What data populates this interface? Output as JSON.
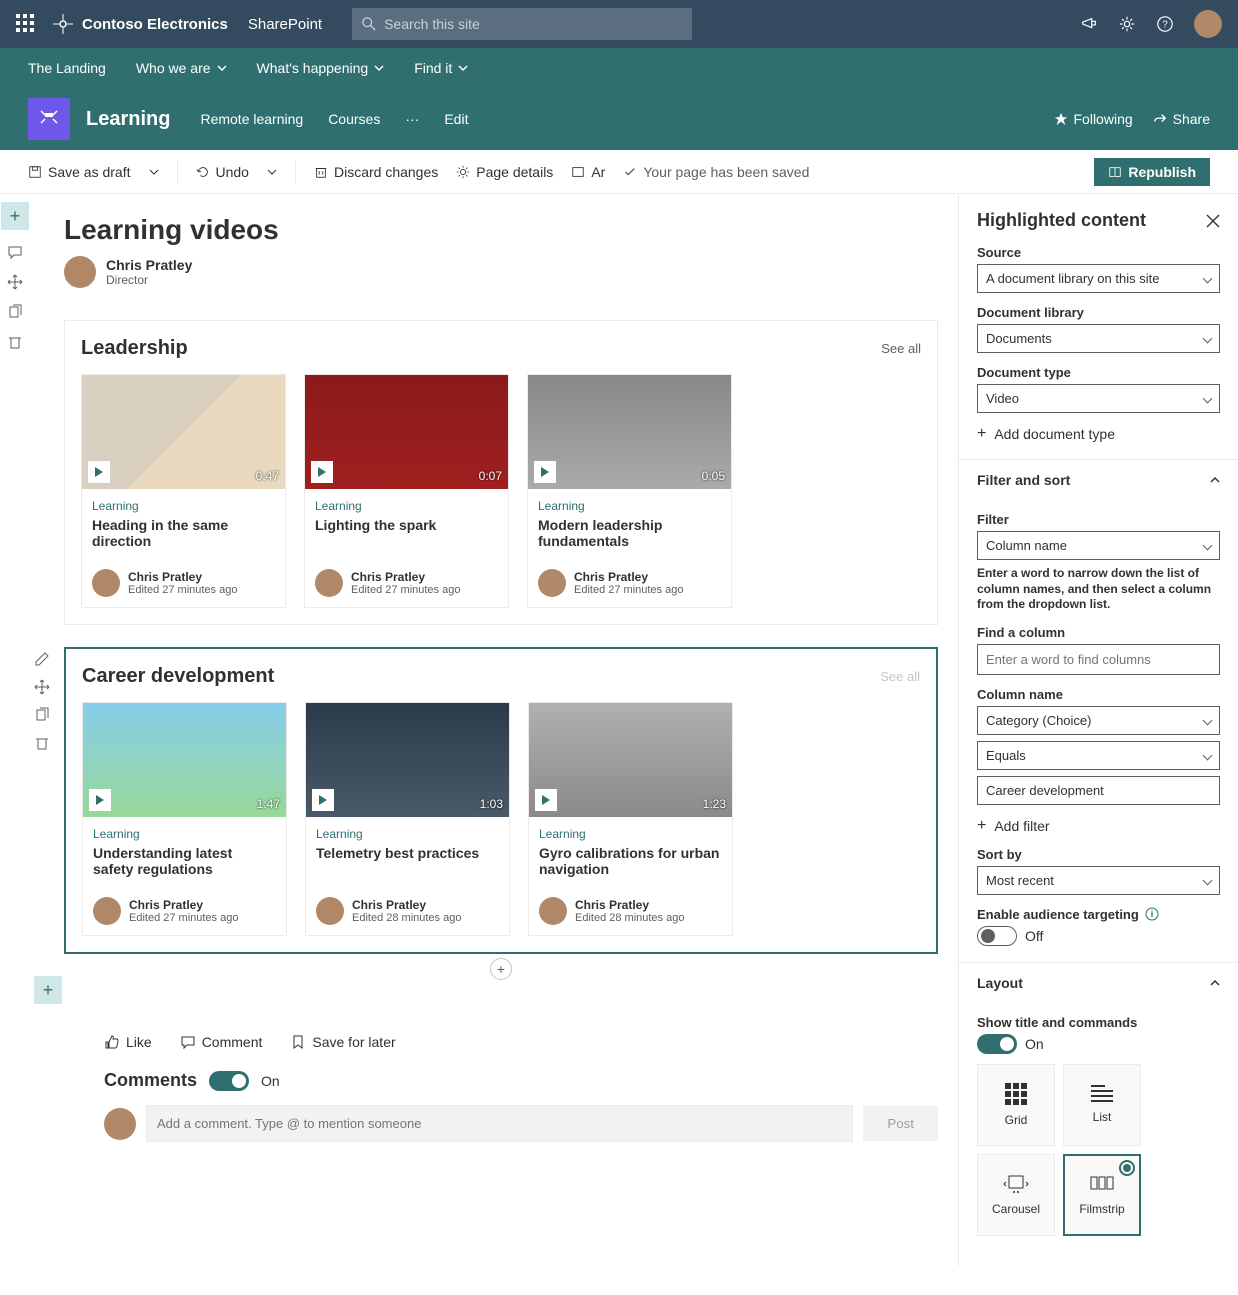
{
  "suite": {
    "brand": "Contoso Electronics",
    "app": "SharePoint",
    "search_placeholder": "Search this site"
  },
  "hubnav": {
    "items": [
      "The Landing",
      "Who we are",
      "What's happening",
      "Find it"
    ]
  },
  "site": {
    "title": "Learning",
    "nav": [
      "Remote learning",
      "Courses"
    ],
    "edit": "Edit",
    "following": "Following",
    "share": "Share"
  },
  "cmdbar": {
    "save": "Save as draft",
    "undo": "Undo",
    "discard": "Discard changes",
    "details": "Page details",
    "ar": "Ar",
    "status": "Your page has been saved",
    "republish": "Republish"
  },
  "page": {
    "title": "Learning videos",
    "author": "Chris Pratley",
    "role": "Director"
  },
  "wp1": {
    "title": "Leadership",
    "seeall": "See all",
    "cards": [
      {
        "cat": "Learning",
        "title": "Heading in the same direction",
        "dur": "0:47",
        "author": "Chris Pratley",
        "edited": "Edited 27 minutes ago"
      },
      {
        "cat": "Learning",
        "title": "Lighting the spark",
        "dur": "0:07",
        "author": "Chris Pratley",
        "edited": "Edited 27 minutes ago"
      },
      {
        "cat": "Learning",
        "title": "Modern leadership fundamentals",
        "dur": "0:05",
        "author": "Chris Pratley",
        "edited": "Edited 27 minutes ago"
      }
    ]
  },
  "wp2": {
    "title": "Career development",
    "seeall": "See all",
    "cards": [
      {
        "cat": "Learning",
        "title": "Understanding latest safety regulations",
        "dur": "1:47",
        "author": "Chris Pratley",
        "edited": "Edited 27 minutes ago"
      },
      {
        "cat": "Learning",
        "title": "Telemetry best practices",
        "dur": "1:03",
        "author": "Chris Pratley",
        "edited": "Edited 28 minutes ago"
      },
      {
        "cat": "Learning",
        "title": "Gyro calibrations for urban navigation",
        "dur": "1:23",
        "author": "Chris Pratley",
        "edited": "Edited 28 minutes ago"
      }
    ]
  },
  "social": {
    "like": "Like",
    "comment": "Comment",
    "save": "Save for later"
  },
  "comments": {
    "title": "Comments",
    "state": "On",
    "placeholder": "Add a comment. Type @ to mention someone",
    "post": "Post"
  },
  "panel": {
    "title": "Highlighted content",
    "source_label": "Source",
    "source": "A document library on this site",
    "doclib_label": "Document library",
    "doclib": "Documents",
    "doctype_label": "Document type",
    "doctype": "Video",
    "add_doctype": "Add document type",
    "filter_sort": "Filter and sort",
    "filter_label": "Filter",
    "filter_value": "Column name",
    "filter_hint": "Enter a word to narrow down the list of column names, and then select a column from the dropdown list.",
    "find_col_label": "Find a column",
    "find_col_placeholder": "Enter a word to find columns",
    "colname_label": "Column name",
    "colname": "Category (Choice)",
    "operator": "Equals",
    "value": "Career development",
    "add_filter": "Add filter",
    "sortby_label": "Sort by",
    "sortby": "Most recent",
    "targeting_label": "Enable audience targeting",
    "targeting": "Off",
    "layout": "Layout",
    "show_title_label": "Show title and commands",
    "show_title": "On",
    "layouts": [
      "Grid",
      "List",
      "Carousel",
      "Filmstrip"
    ]
  }
}
